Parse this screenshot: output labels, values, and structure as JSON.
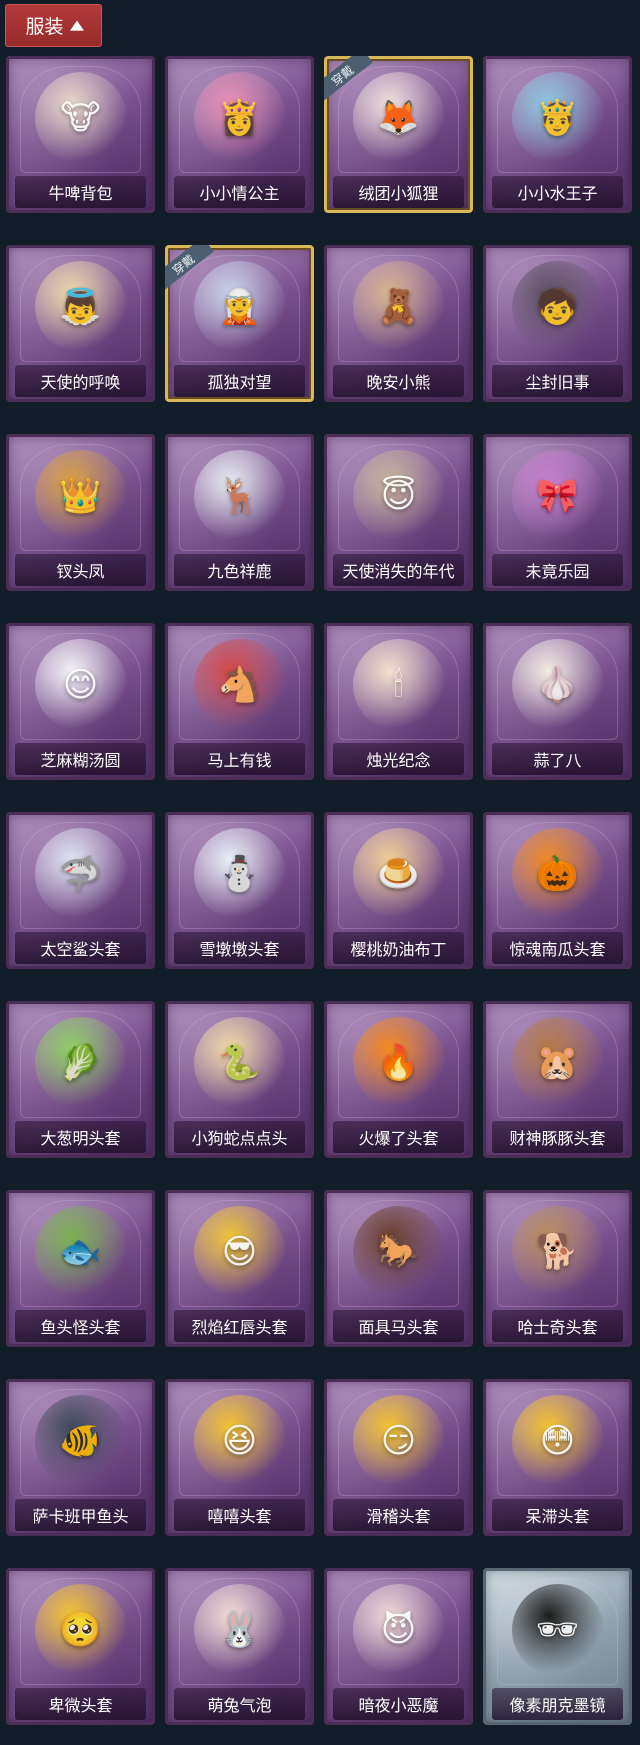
{
  "header": {
    "label": "服装",
    "chevron_icon": "chevron-up-icon"
  },
  "worn_tag": "穿戴",
  "items": [
    {
      "name": "牛啤背包",
      "icon": "cow-backpack-icon",
      "color": "#e8d9c8",
      "glyph": "🐮"
    },
    {
      "name": "小小情公主",
      "icon": "pink-princess-icon",
      "color": "#e98fb6",
      "glyph": "👸"
    },
    {
      "name": "绒团小狐狸",
      "icon": "fox-charm-icon",
      "color": "#efe2dd",
      "glyph": "🦊",
      "worn": true
    },
    {
      "name": "小小水王子",
      "icon": "water-prince-icon",
      "color": "#8cc9e0",
      "glyph": "🤴"
    },
    {
      "name": "天使的呼唤",
      "icon": "angel-icon",
      "color": "#f0d9a8",
      "glyph": "👼"
    },
    {
      "name": "孤独对望",
      "icon": "lonely-gaze-icon",
      "color": "#c9d3ea",
      "glyph": "🧝",
      "worn": true
    },
    {
      "name": "晚安小熊",
      "icon": "bear-icon",
      "color": "#d9b48f",
      "glyph": "🧸"
    },
    {
      "name": "尘封旧事",
      "icon": "dark-boy-icon",
      "color": "#5a5060",
      "glyph": "🧒"
    },
    {
      "name": "钗头凤",
      "icon": "phoenix-crown-icon",
      "color": "#d9a040",
      "glyph": "👑"
    },
    {
      "name": "九色祥鹿",
      "icon": "deer-icon",
      "color": "#e6ecf2",
      "glyph": "🦌"
    },
    {
      "name": "天使消失的年代",
      "icon": "lost-angel-icon",
      "color": "#c8b49a",
      "glyph": "😇"
    },
    {
      "name": "未竟乐园",
      "icon": "unfinished-paradise-icon",
      "color": "#c77fd0",
      "glyph": "🎀"
    },
    {
      "name": "芝麻糊汤圆",
      "icon": "sesame-dumpling-icon",
      "color": "#f4f4f8",
      "glyph": "😊"
    },
    {
      "name": "马上有钱",
      "icon": "red-horse-icon",
      "color": "#d44848",
      "glyph": "🐴"
    },
    {
      "name": "烛光纪念",
      "icon": "candle-icon",
      "color": "#f3e0cc",
      "glyph": "🕯"
    },
    {
      "name": "蒜了八",
      "icon": "garlic-icon",
      "color": "#f1ece2",
      "glyph": "🧄"
    },
    {
      "name": "太空鲨头套",
      "icon": "shark-helmet-icon",
      "color": "#dfe6f2",
      "glyph": "🦈"
    },
    {
      "name": "雪墩墩头套",
      "icon": "snowman-helmet-icon",
      "color": "#e9f1f8",
      "glyph": "⛄"
    },
    {
      "name": "樱桃奶油布丁",
      "icon": "pudding-helmet-icon",
      "color": "#f0cf96",
      "glyph": "🍮"
    },
    {
      "name": "惊魂南瓜头套",
      "icon": "pumpkin-helmet-icon",
      "color": "#f08a25",
      "glyph": "🎃"
    },
    {
      "name": "大葱明头套",
      "icon": "scallion-helmet-icon",
      "color": "#8ed062",
      "glyph": "🥬"
    },
    {
      "name": "小狗蛇点点头",
      "icon": "snake-helmet-icon",
      "color": "#f2dba6",
      "glyph": "🐍"
    },
    {
      "name": "火爆了头套",
      "icon": "fire-helmet-icon",
      "color": "#f6891e",
      "glyph": "🔥"
    },
    {
      "name": "财神豚豚头套",
      "icon": "capybara-helmet-icon",
      "color": "#b67a45",
      "glyph": "🐹"
    },
    {
      "name": "鱼头怪头套",
      "icon": "fish-helmet-icon",
      "color": "#79b24f",
      "glyph": "🐟"
    },
    {
      "name": "烈焰红唇头套",
      "icon": "yellow-mask-icon",
      "color": "#f0c435",
      "glyph": "😎"
    },
    {
      "name": "面具马头套",
      "icon": "horse-mask-icon",
      "color": "#6a3f2a",
      "glyph": "🐎"
    },
    {
      "name": "哈士奇头套",
      "icon": "dog-mask-icon",
      "color": "#b88c5a",
      "glyph": "🐕"
    },
    {
      "name": "萨卡班甲鱼头",
      "icon": "sacabambaspis-icon",
      "color": "#3f4a5a",
      "glyph": "🐠"
    },
    {
      "name": "嘻嘻头套",
      "icon": "grin-emoji-icon",
      "color": "#f4c430",
      "glyph": "😆"
    },
    {
      "name": "滑稽头套",
      "icon": "funny-emoji-icon",
      "color": "#f4c430",
      "glyph": "😏"
    },
    {
      "name": "呆滞头套",
      "icon": "dazed-emoji-icon",
      "color": "#f4c430",
      "glyph": "😳"
    },
    {
      "name": "卑微头套",
      "icon": "humble-emoji-icon",
      "color": "#f4c430",
      "glyph": "🥺"
    },
    {
      "name": "萌兔气泡",
      "icon": "bunny-bubble-icon",
      "color": "#f1dcd5",
      "glyph": "🐰"
    },
    {
      "name": "暗夜小恶魔",
      "icon": "little-devil-icon",
      "color": "#f0d8d6",
      "glyph": "😈"
    },
    {
      "name": "像素朋克墨镜",
      "icon": "pixel-sunglasses-icon",
      "color": "#1c1c1c",
      "glyph": "🕶",
      "silver": true
    }
  ]
}
